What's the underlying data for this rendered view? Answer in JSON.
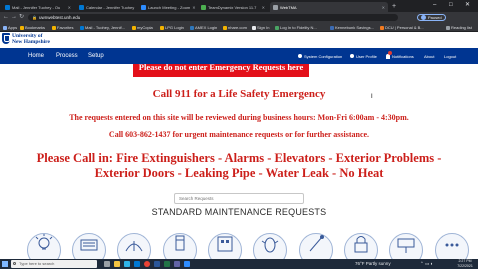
{
  "browser": {
    "tabs": [
      {
        "label": "Mail - Jennifer Tuohey - Ou",
        "favicon_color": "#0078d4"
      },
      {
        "label": "Calendar - Jennifer Tuohey",
        "favicon_color": "#0078d4"
      },
      {
        "label": "Launch Meeting - Zoom",
        "favicon_color": "#2d8cff"
      },
      {
        "label": "TeamDynamix Version 11.7",
        "favicon_color": "#4caf50"
      },
      {
        "label": "WebTMA",
        "favicon_color": "#9aa0a6",
        "active": true
      }
    ],
    "new_tab_label": "+",
    "window_controls": {
      "minimize": "–",
      "maximize": "□",
      "close": "✕"
    },
    "nav": {
      "back": "←",
      "forward": "→",
      "reload": "↻"
    },
    "url": "uwnwebtest.unh.edu",
    "profile_label": "Paused",
    "bookmarks": [
      "Apps",
      "Bookmarks",
      "Favorites",
      "Mail - Tuohey, Jennif...",
      "myCopia",
      "LPG Login",
      "AMEX Login",
      "nhare.com",
      "Sign In",
      "Log In to Fidelity N...",
      "Kennebunk Savings...",
      "DCU | Personal & B...",
      "Reading list"
    ]
  },
  "header": {
    "org_line1": "University of",
    "org_line2": "New Hampshire",
    "logo_icon": "unh-crest-icon"
  },
  "site_nav": {
    "items": [
      "Home",
      "Process",
      "Setup"
    ],
    "right_items": [
      "System Configuration",
      "User Profile",
      "Notifications",
      "About",
      "Logout"
    ]
  },
  "content": {
    "emergency_banner": "Please do not enter Emergency Requests here",
    "call_911": "Call 911 for a Life Safety Emergency",
    "hours_notice": "The requests entered on this site will be reviewed during business hours: Mon-Fri 6:00am - 4:30pm.",
    "phone_prefix": "Call",
    "phone_number": "603-862-1437",
    "phone_suffix": "for urgent maintenance requests or for further assistance.",
    "please_call": "Please Call in: Fire Extinguishers - Alarms - Elevators - Exterior Problems - Exterior Doors - Leaking Pipe - Water Leak - No Heat",
    "search_placeholder": "Search Requests",
    "section_title": "STANDARD MAINTENANCE REQUESTS",
    "service_icons": [
      "lightbulb-icon",
      "hvac-icon",
      "grounds-icon",
      "plumbing-icon",
      "building-icon",
      "pest-icon",
      "cleaning-icon",
      "lock-icon",
      "signage-icon",
      "other-icon"
    ]
  },
  "taskbar": {
    "search_placeholder": "Type here to search",
    "weather": "76°F  Partly sunny",
    "time": "2:27 PM",
    "date": "7/22/2021"
  },
  "colors": {
    "unh_blue": "#003591",
    "alert_red": "#cc1f1a",
    "banner_red": "#e3101a"
  }
}
